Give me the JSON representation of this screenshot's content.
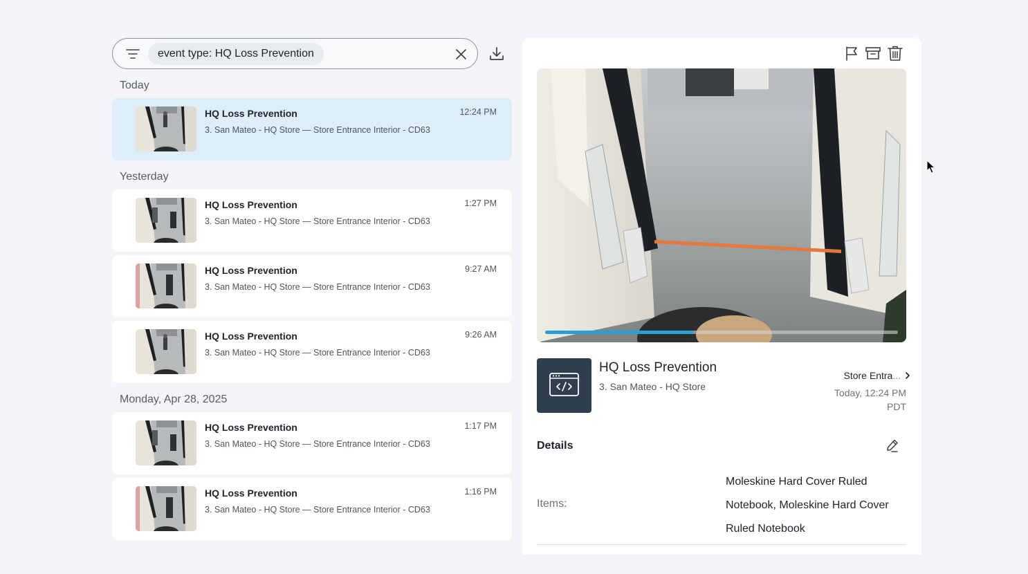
{
  "search": {
    "filter_chip": "event type: HQ Loss Prevention"
  },
  "groups": [
    {
      "label": "Today",
      "events": [
        {
          "title": "HQ Loss Prevention",
          "location": "3. San Mateo - HQ Store — Store Entrance Interior - CD63",
          "time": "12:24 PM",
          "selected": true
        }
      ]
    },
    {
      "label": "Yesterday",
      "events": [
        {
          "title": "HQ Loss Prevention",
          "location": "3. San Mateo - HQ Store — Store Entrance Interior - CD63",
          "time": "1:27 PM"
        },
        {
          "title": "HQ Loss Prevention",
          "location": "3. San Mateo - HQ Store — Store Entrance Interior - CD63",
          "time": "9:27 AM"
        },
        {
          "title": "HQ Loss Prevention",
          "location": "3. San Mateo - HQ Store — Store Entrance Interior - CD63",
          "time": "9:26 AM"
        }
      ]
    },
    {
      "label": "Monday, Apr 28, 2025",
      "events": [
        {
          "title": "HQ Loss Prevention",
          "location": "3. San Mateo - HQ Store — Store Entrance Interior - CD63",
          "time": "1:17 PM"
        },
        {
          "title": "HQ Loss Prevention",
          "location": "3. San Mateo - HQ Store — Store Entrance Interior - CD63",
          "time": "1:16 PM"
        }
      ]
    }
  ],
  "detail": {
    "title": "HQ Loss Prevention",
    "site": "3. San Mateo - HQ Store",
    "camera_prefix": "Store Entra",
    "camera_ellipsis": "...",
    "time_line1": "Today, 12:24 PM",
    "time_line2": "PDT",
    "video_progress": 0.42,
    "details_heading": "Details",
    "items_label": "Items:",
    "items_value": "Moleskine Hard Cover Ruled Notebook, Moleskine Hard Cover Ruled Notebook"
  },
  "icons": {
    "filter": "filter-icon",
    "clear": "close-icon",
    "download": "download-icon",
    "flag": "flag-icon",
    "archive": "archive-icon",
    "trash": "trash-icon",
    "badge": "code-window-icon",
    "chevron": "chevron-right-icon",
    "edit": "pencil-icon"
  },
  "colors": {
    "selected_row": "#ddeef8",
    "accent": "#2a9fd6",
    "badge_bg": "#2f3f4f"
  }
}
